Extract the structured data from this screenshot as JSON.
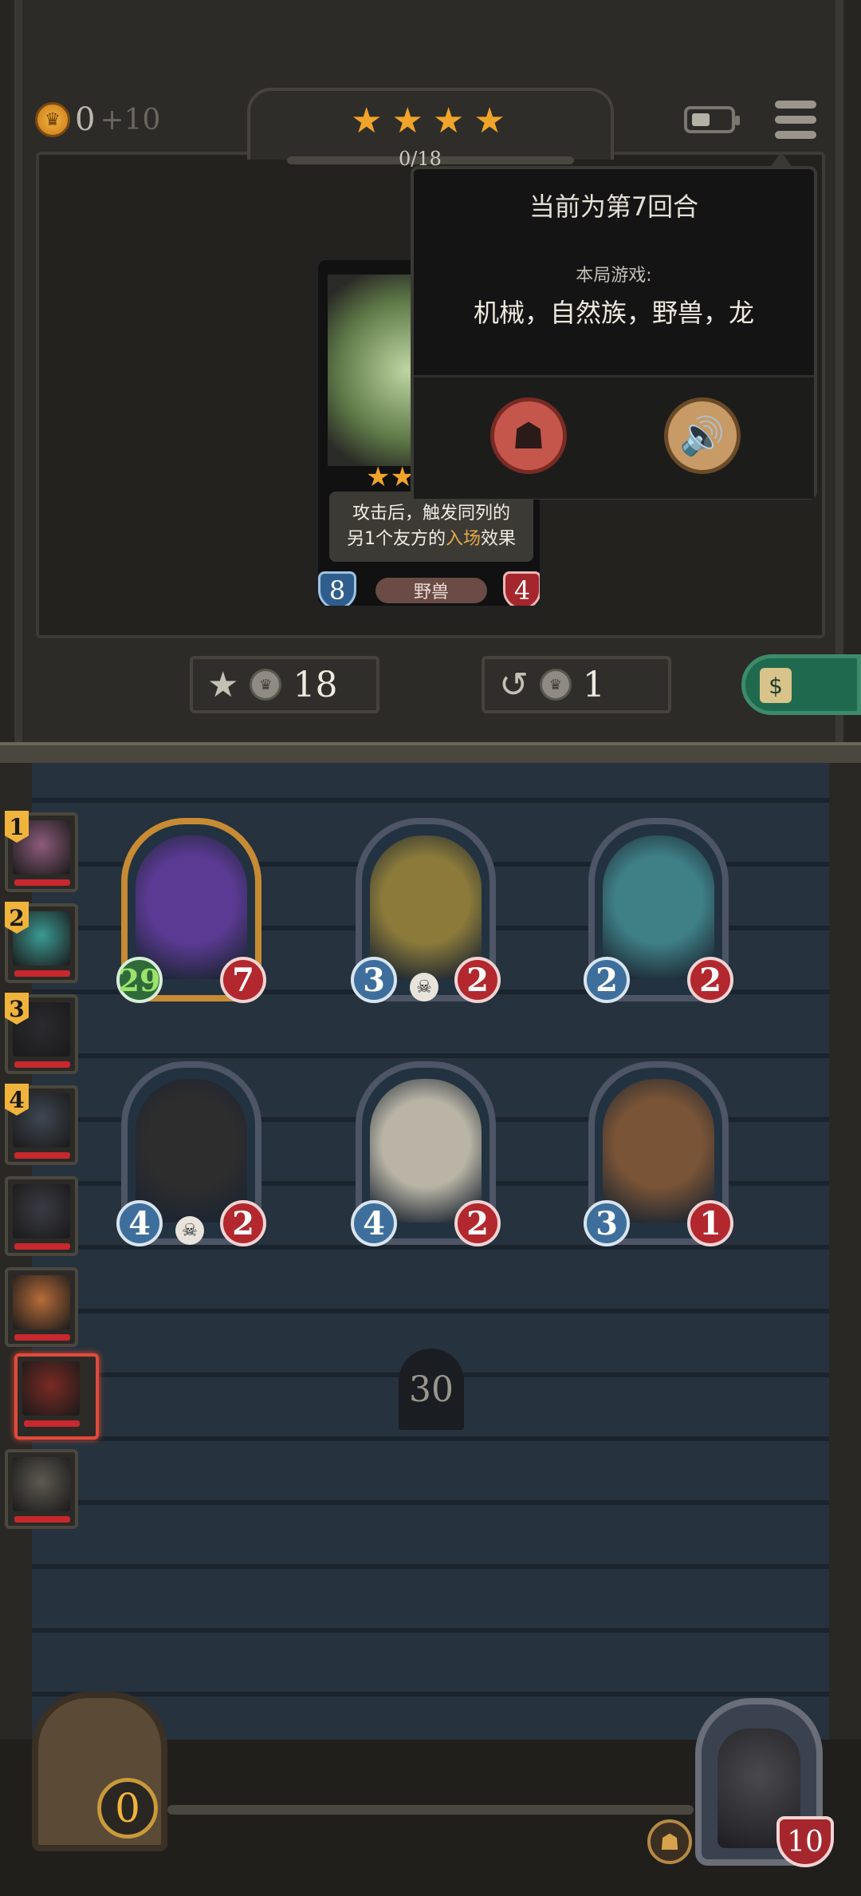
{
  "top": {
    "gold": "0",
    "gold_income": "+10",
    "tier_stars": 4,
    "progress": "0/18"
  },
  "offer_card": {
    "description_line1": "攻击后，触发同列的",
    "description_line2_pre": "另1个友方的",
    "description_line2_hl": "入场",
    "description_line2_post": "效果",
    "attack": "8",
    "health": "4",
    "tribe": "野兽",
    "stars": "★★"
  },
  "menu_popup": {
    "round": "当前为第7回合",
    "game_label": "本局游戏:",
    "tribes": "机械，自然族，野兽，龙"
  },
  "actions": {
    "upgrade_cost": "18",
    "refresh_cost": "1"
  },
  "board": {
    "minions": [
      {
        "name": "purple-dragon",
        "attack": "29",
        "health": "7",
        "golden": true,
        "art": "#5b3a93"
      },
      {
        "name": "gold-dragon",
        "attack": "3",
        "health": "2",
        "skull": true,
        "art": "#8b7a3a"
      },
      {
        "name": "fish-tank-mech",
        "attack": "2",
        "health": "2",
        "art": "#3f7f86"
      },
      {
        "name": "black-spider",
        "attack": "4",
        "health": "2",
        "skull": true,
        "art": "#2e2d2e"
      },
      {
        "name": "white-bird",
        "attack": "4",
        "health": "2",
        "art": "#b9b4a5"
      },
      {
        "name": "drill-robot",
        "attack": "3",
        "health": "1",
        "art": "#7a5436"
      }
    ],
    "timer": "30"
  },
  "players": [
    {
      "rank": "1",
      "face": "#8c5b7a"
    },
    {
      "rank": "2",
      "face": "#3b9a94"
    },
    {
      "rank": "3",
      "face": "#2b2a2e"
    },
    {
      "rank": "4",
      "face": "#3e4752"
    },
    {
      "rank": "",
      "face": "#3a3a44"
    },
    {
      "rank": "",
      "face": "#b86c3a"
    },
    {
      "rank": "",
      "face": "#7a2a24",
      "active": true
    },
    {
      "rank": "",
      "face": "#5e5a50"
    }
  ],
  "bottom": {
    "chest_gold": "0",
    "hero_health": "10"
  }
}
